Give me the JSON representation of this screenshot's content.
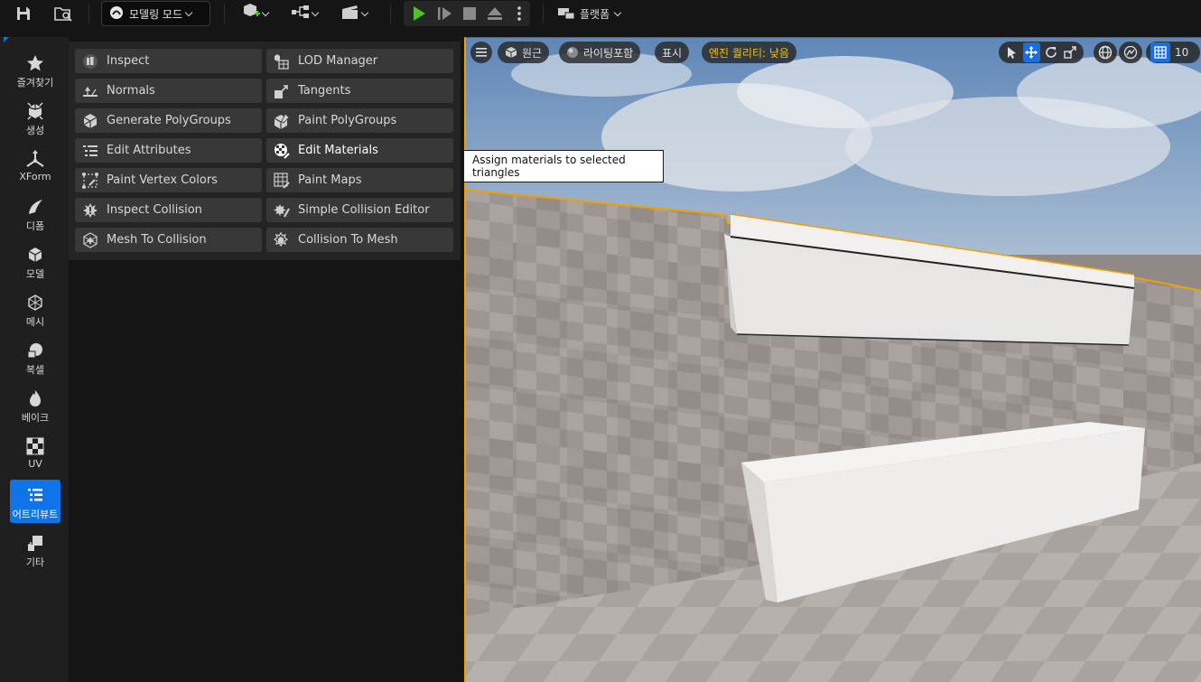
{
  "toolbar": {
    "mode_label": "모델링 모드",
    "platform_label": "플랫폼"
  },
  "categories": [
    {
      "label": "즐겨찾기",
      "icon": "star-icon"
    },
    {
      "label": "생성",
      "icon": "create-icon"
    },
    {
      "label": "XForm",
      "icon": "xform-icon"
    },
    {
      "label": "디폼",
      "icon": "deform-icon"
    },
    {
      "label": "모델",
      "icon": "model-icon"
    },
    {
      "label": "메시",
      "icon": "mesh-icon"
    },
    {
      "label": "복셀",
      "icon": "voxel-icon"
    },
    {
      "label": "베이크",
      "icon": "bake-icon"
    },
    {
      "label": "UV",
      "icon": "uv-icon"
    },
    {
      "label": "어트리뷰트",
      "icon": "attributes-icon",
      "active": true
    },
    {
      "label": "기타",
      "icon": "misc-icon"
    }
  ],
  "tools": {
    "left": [
      {
        "label": "Inspect",
        "icon": "inspect-icon"
      },
      {
        "label": "Normals",
        "icon": "normals-icon"
      },
      {
        "label": "Generate PolyGroups",
        "icon": "generate-polygroups-icon"
      },
      {
        "label": "Edit Attributes",
        "icon": "edit-attributes-icon"
      },
      {
        "label": "Paint Vertex Colors",
        "icon": "paint-vertex-colors-icon"
      },
      {
        "label": "Inspect Collision",
        "icon": "inspect-collision-icon"
      },
      {
        "label": "Mesh To Collision",
        "icon": "mesh-to-collision-icon"
      }
    ],
    "right": [
      {
        "label": "LOD Manager",
        "icon": "lod-manager-icon"
      },
      {
        "label": "Tangents",
        "icon": "tangents-icon"
      },
      {
        "label": "Paint PolyGroups",
        "icon": "paint-polygroups-icon"
      },
      {
        "label": "Edit Materials",
        "icon": "edit-materials-icon",
        "selected": true
      },
      {
        "label": "Paint Maps",
        "icon": "paint-maps-icon"
      },
      {
        "label": "Simple Collision Editor",
        "icon": "simple-collision-editor-icon"
      },
      {
        "label": "Collision To Mesh",
        "icon": "collision-to-mesh-icon"
      }
    ]
  },
  "viewport": {
    "perspective_label": "원근",
    "lighting_label": "라이팅포함",
    "show_label": "표시",
    "quality_label": "엔진 퀄리티: 낮음",
    "grid_value": "10",
    "accent_color": "#1a6fe0",
    "selection_color": "#f0a000",
    "quality_color": "#f3c200"
  },
  "tooltip": {
    "text": "Assign materials to selected triangles"
  }
}
